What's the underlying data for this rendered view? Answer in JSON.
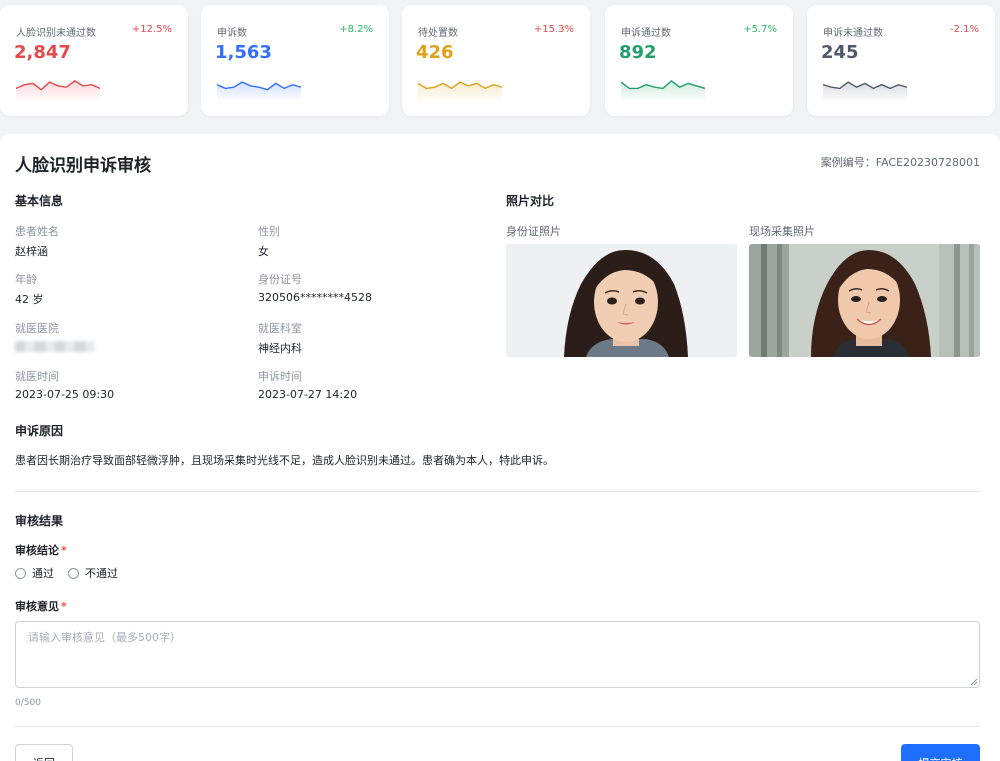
{
  "stats": [
    {
      "label": "人脸识别未通过数",
      "value": "2,847",
      "change": "+12.5%",
      "color": "#e5484d",
      "change_color": "#e5484d",
      "trend": [
        0.3,
        0.45,
        0.5,
        0.25,
        0.55,
        0.4,
        0.35,
        0.6,
        0.4,
        0.45,
        0.3
      ]
    },
    {
      "label": "申诉数",
      "value": "1,563",
      "change": "+8.2%",
      "color": "#3370ff",
      "change_color": "#2fb56b",
      "trend": [
        0.45,
        0.3,
        0.35,
        0.55,
        0.4,
        0.35,
        0.25,
        0.5,
        0.3,
        0.45,
        0.35
      ]
    },
    {
      "label": "待处置数",
      "value": "426",
      "change": "+15.3%",
      "color": "#e0a11b",
      "change_color": "#e5484d",
      "trend": [
        0.5,
        0.3,
        0.35,
        0.5,
        0.3,
        0.55,
        0.4,
        0.5,
        0.3,
        0.45,
        0.35
      ]
    },
    {
      "label": "申诉通过数",
      "value": "892",
      "change": "+5.7%",
      "color": "#22a06b",
      "change_color": "#2fb56b",
      "trend": [
        0.55,
        0.3,
        0.3,
        0.45,
        0.35,
        0.3,
        0.6,
        0.35,
        0.5,
        0.4,
        0.3
      ]
    },
    {
      "label": "申诉未通过数",
      "value": "245",
      "change": "-2.1%",
      "color": "#4e5969",
      "change_color": "#e5484d",
      "trend": [
        0.45,
        0.35,
        0.3,
        0.55,
        0.35,
        0.5,
        0.3,
        0.45,
        0.3,
        0.45,
        0.35
      ]
    }
  ],
  "review": {
    "title": "人脸识别申诉审核",
    "case_no": "案例编号：FACE20230728001",
    "basic_info": {
      "title": "基本信息",
      "fields": {
        "name": {
          "label": "患者姓名",
          "value": "赵梓涵"
        },
        "gender": {
          "label": "性别",
          "value": "女"
        },
        "age": {
          "label": "年龄",
          "value": "42 岁"
        },
        "id_number": {
          "label": "身份证号",
          "value": "320506********4528"
        },
        "hospital": {
          "label": "就医医院"
        },
        "department": {
          "label": "就医科室",
          "value": "神经内科"
        },
        "visit_time": {
          "label": "就医时间",
          "value": "2023-07-25 09:30"
        },
        "appeal_time": {
          "label": "申诉时间",
          "value": "2023-07-27 14:20"
        }
      }
    },
    "photos": {
      "title": "照片对比",
      "id_photo_label": "身份证照片",
      "live_photo_label": "现场采集照片"
    },
    "reason": {
      "title": "申诉原因",
      "text": "患者因长期治疗导致面部轻微浮肿，且现场采集时光线不足，造成人脸识别未通过。患者确为本人，特此申诉。"
    },
    "result": {
      "title": "审核结果",
      "conclusion_label": "审核结论",
      "options": [
        "通过",
        "不通过"
      ],
      "opinion_label": "审核意见",
      "opinion_placeholder": "请输入审核意见（最多500字）",
      "counter": "0/500",
      "required_mark": "*"
    },
    "buttons": {
      "back": "返回",
      "submit": "提交审核"
    }
  }
}
